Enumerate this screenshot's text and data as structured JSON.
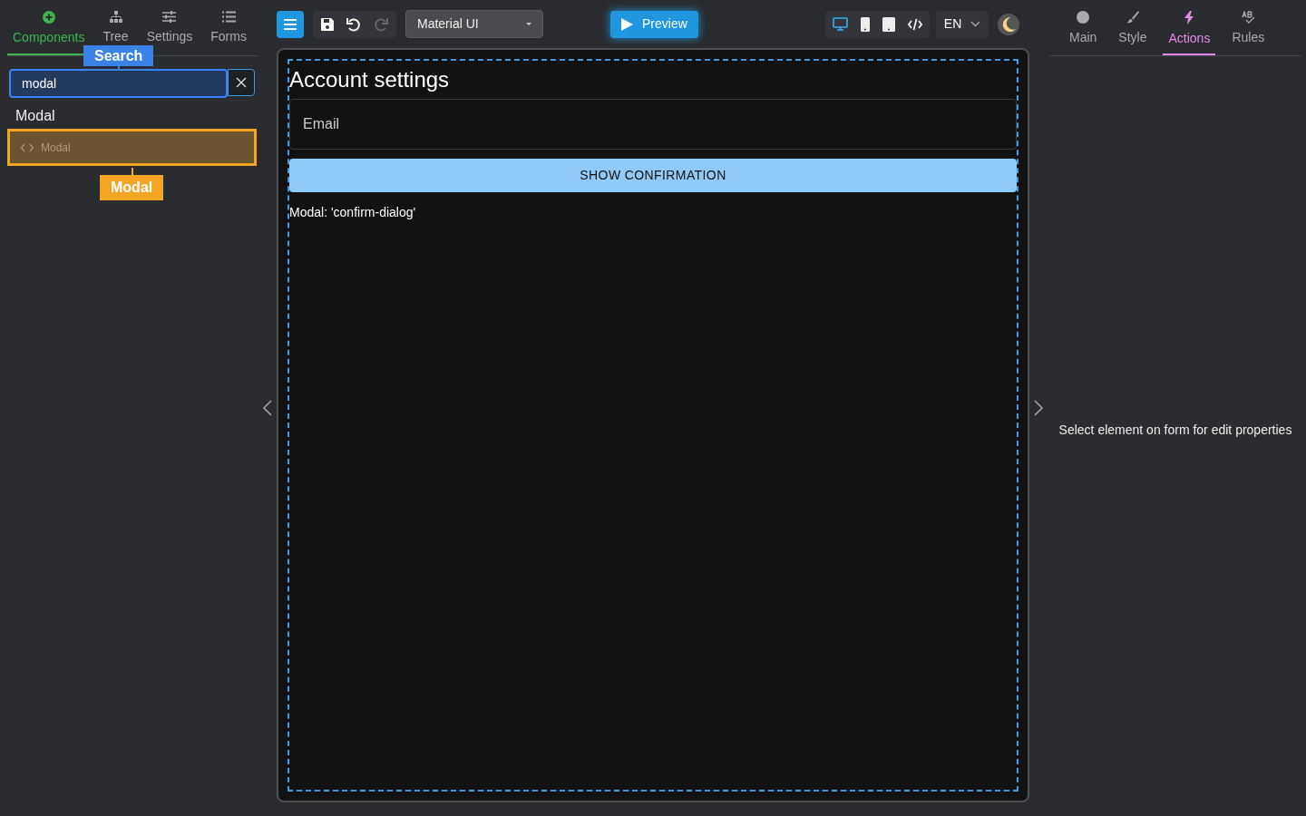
{
  "left_tabs": [
    {
      "label": "Components",
      "selected": true
    },
    {
      "label": "Tree",
      "selected": false
    },
    {
      "label": "Settings",
      "selected": false
    },
    {
      "label": "Forms",
      "selected": false
    }
  ],
  "search": {
    "value": "modal",
    "tooltip": "Search"
  },
  "results": {
    "group": "Modal",
    "items": [
      {
        "label": "Modal",
        "tooltip": "Modal",
        "highlighted": true
      }
    ]
  },
  "toolbar": {
    "library": "Material UI",
    "preview": "Preview",
    "devices": [
      {
        "kind": "desktop",
        "selected": true
      },
      {
        "kind": "phone",
        "selected": false
      },
      {
        "kind": "tablet",
        "selected": false
      },
      {
        "kind": "code",
        "selected": false
      }
    ],
    "language": "EN"
  },
  "form": {
    "title": "Account settings",
    "email_placeholder": "Email",
    "button": "SHOW CONFIRMATION",
    "note": "Modal: 'confirm-dialog'"
  },
  "right_tabs": [
    {
      "label": "Main",
      "selected": false
    },
    {
      "label": "Style",
      "selected": false
    },
    {
      "label": "Actions",
      "selected": true
    },
    {
      "label": "Rules",
      "selected": false
    }
  ],
  "right_message": "Select element on form for edit properties"
}
